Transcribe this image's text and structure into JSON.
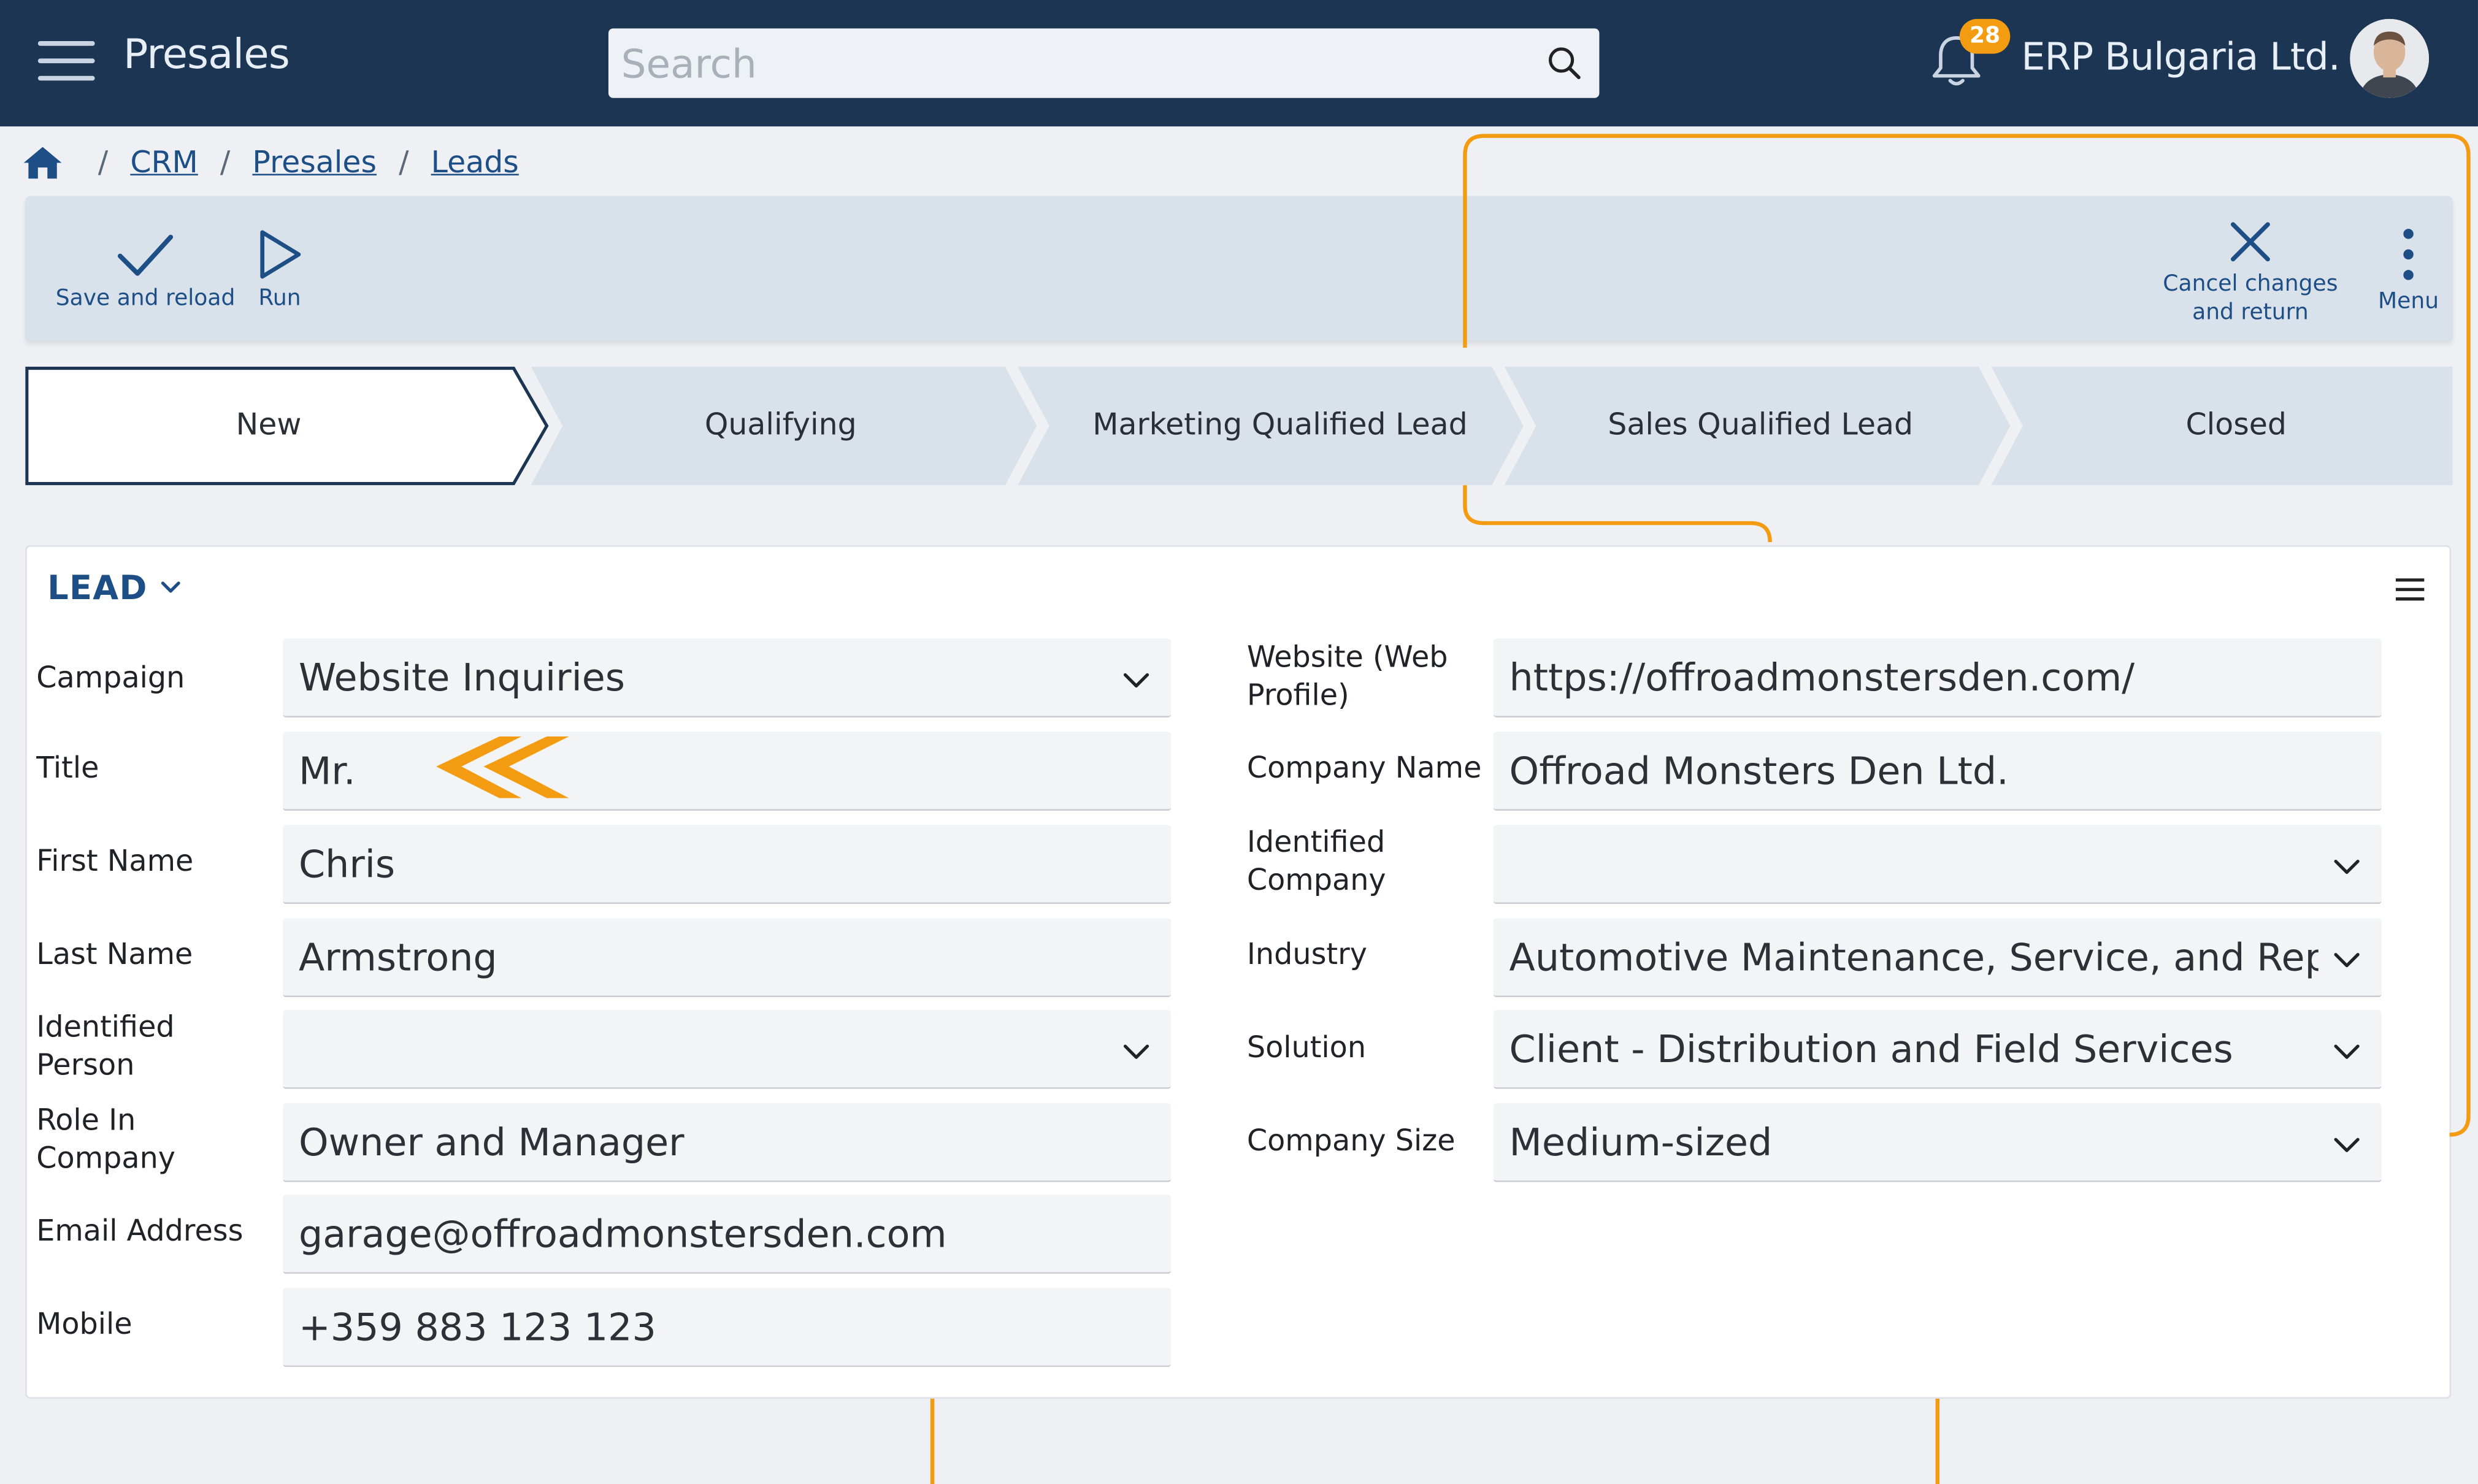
{
  "header": {
    "app_title": "Presales",
    "search_placeholder": "Search",
    "notifications_count": "28",
    "company_name": "ERP Bulgaria Ltd."
  },
  "breadcrumb": {
    "items": [
      "CRM",
      "Presales",
      "Leads"
    ]
  },
  "toolbar": {
    "save_label": "Save and reload",
    "run_label": "Run",
    "cancel_label_line1": "Cancel changes",
    "cancel_label_line2": "and return",
    "menu_label": "Menu"
  },
  "stages": {
    "items": [
      "New",
      "Qualifying",
      "Marketing Qualified Lead",
      "Sales Qualified Lead",
      "Closed"
    ],
    "active": "New"
  },
  "lead": {
    "section_title": "LEAD",
    "left": [
      {
        "label_line1": "Campaign",
        "label_line2": "",
        "value": "Website Inquiries",
        "type": "select"
      },
      {
        "label_line1": "Title",
        "label_line2": "",
        "value": "Mr.",
        "type": "text"
      },
      {
        "label_line1": "First Name",
        "label_line2": "",
        "value": "Chris",
        "type": "text"
      },
      {
        "label_line1": "Last Name",
        "label_line2": "",
        "value": "Armstrong",
        "type": "text"
      },
      {
        "label_line1": "Identified",
        "label_line2": "Person",
        "value": "",
        "type": "select"
      },
      {
        "label_line1": "Role In",
        "label_line2": "Company",
        "value": "Owner and Manager",
        "type": "text"
      },
      {
        "label_line1": "Email Address",
        "label_line2": "",
        "value": "garage@offroadmonstersden.com",
        "type": "text"
      },
      {
        "label_line1": "Mobile",
        "label_line2": "",
        "value": "+359 883 123 123",
        "type": "text"
      }
    ],
    "right": [
      {
        "label_line1": "Website (Web",
        "label_line2": "Profile)",
        "value": "https://offroadmonstersden.com/",
        "type": "text"
      },
      {
        "label_line1": "Company Name",
        "label_line2": "",
        "value": "Offroad Monsters Den Ltd.",
        "type": "text"
      },
      {
        "label_line1": "Identified",
        "label_line2": "Company",
        "value": "",
        "type": "select"
      },
      {
        "label_line1": "Industry",
        "label_line2": "",
        "value": "Automotive Maintenance, Service, and Repa",
        "type": "select"
      },
      {
        "label_line1": "Solution",
        "label_line2": "",
        "value": "Client - Distribution and Field Services",
        "type": "select"
      },
      {
        "label_line1": "Company Size",
        "label_line2": "",
        "value": "Medium-sized",
        "type": "select"
      }
    ]
  },
  "colors": {
    "header_bg": "#1b3553",
    "accent_blue": "#1d4f86",
    "annotation_orange": "#f39c12",
    "badge": "#f39c12"
  }
}
